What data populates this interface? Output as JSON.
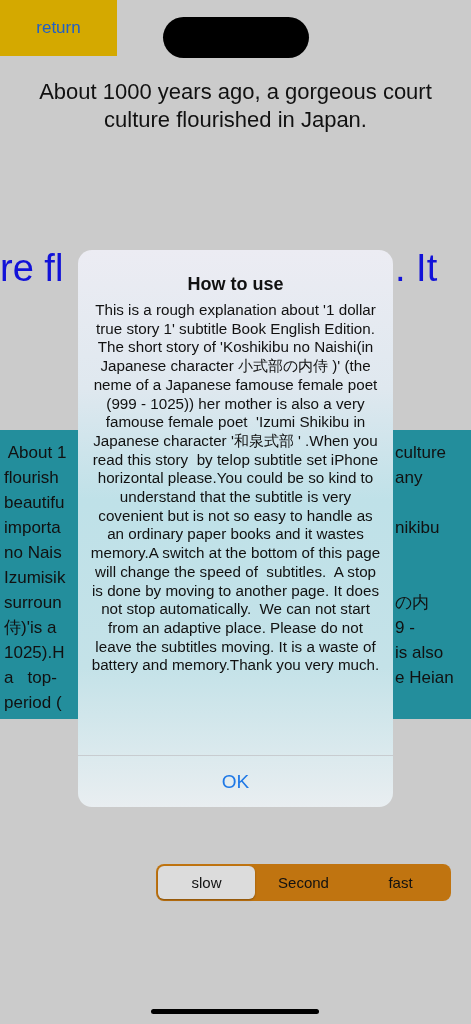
{
  "return_button": {
    "label": "return"
  },
  "heading": "About 1000 years ago, a gorgeous court culture flourished in Japan.",
  "marquee": {
    "left": "re fl",
    "right": ". It"
  },
  "subtitle_panel": {
    "rows": [
      {
        "left": " About 1",
        "right": "culture"
      },
      {
        "left": "flourish",
        "right": "any"
      },
      {
        "left": "beautifu",
        "right": ""
      },
      {
        "left": "importa",
        "right": "nikibu"
      },
      {
        "left": "no Nais",
        "right": ""
      },
      {
        "left": "Izumisik",
        "right": ""
      },
      {
        "left": "surroun",
        "right": "の内"
      },
      {
        "left": "侍)'is a",
        "right": "9 -"
      },
      {
        "left": "1025).H",
        "right": "is also"
      },
      {
        "left": "a   top-",
        "right": "e Heian"
      },
      {
        "left": "period (",
        "right": ""
      }
    ]
  },
  "dialog": {
    "title": "How to use",
    "message": "This is a rough explanation about '1 dollar true story 1' subtitle Book English Edition.  The short story of 'Koshikibu no Naishi(in Japanese character 小式部の内侍 )' (the neme of a Japanese famouse female poet (999 - 1025)) her mother is also a very famouse female poet  'Izumi Shikibu in Japanese character '和泉式部 ' .When you read this story  by telop subtitle set iPhone horizontal please.You could be so kind to understand that the subtitle is very covenient but is not so easy to handle as an ordinary paper books and it wastes memory.A switch at the bottom of this page will change the speed of  subtitles.  A stop is done by moving to another page. It does not stop automatically.  We can not start from an adaptive place. Please do not leave the subtitles moving. It is a waste of battery and memory.Thank you very much.",
    "button": "OK"
  },
  "speed_control": [
    {
      "label": "slow",
      "selected": true
    },
    {
      "label": "Second",
      "selected": false
    },
    {
      "label": "fast",
      "selected": false
    }
  ]
}
